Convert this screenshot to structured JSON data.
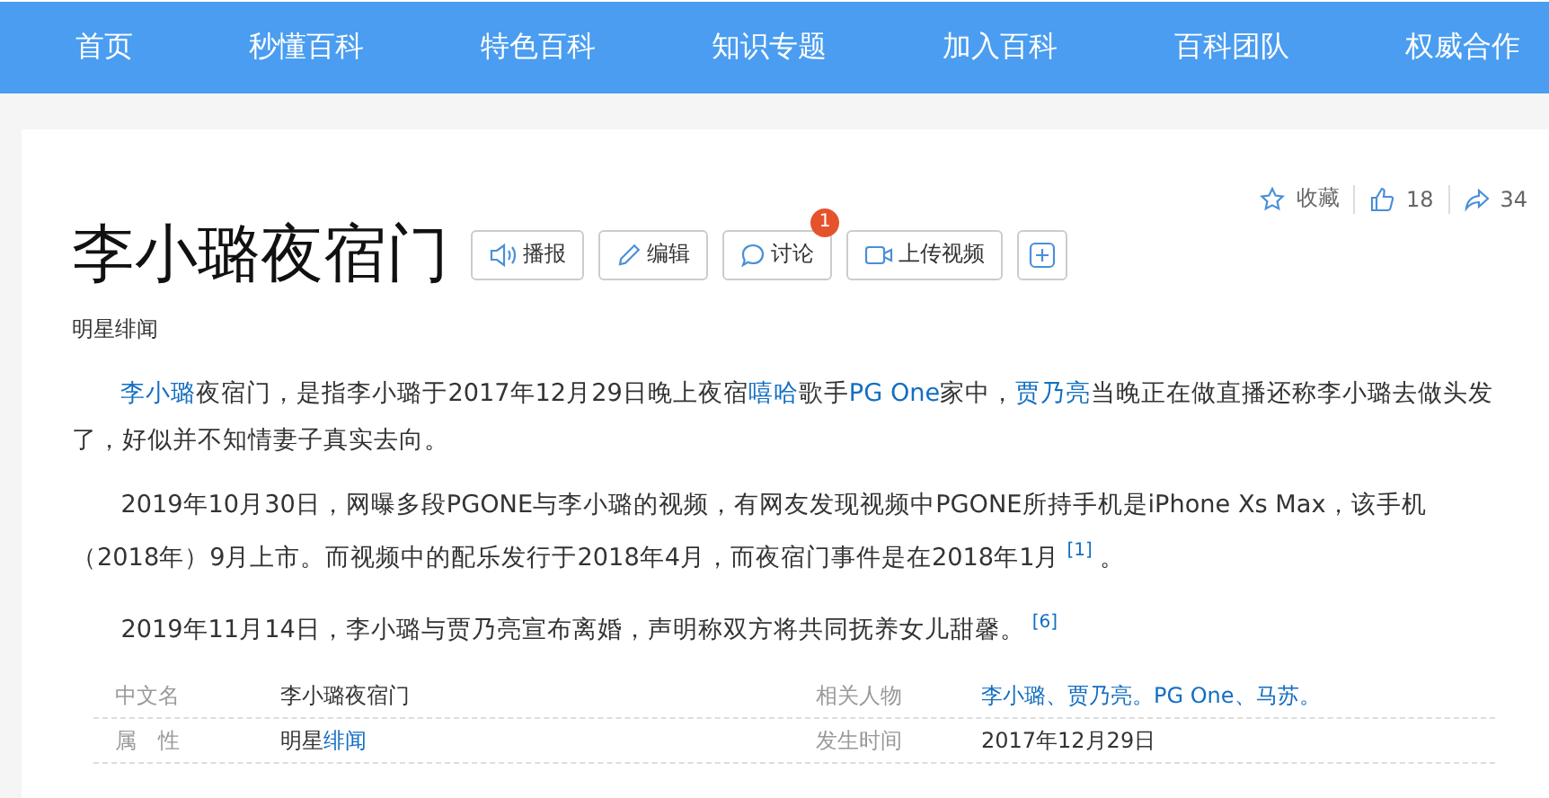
{
  "nav": [
    {
      "label": "首页"
    },
    {
      "label": "秒懂百科"
    },
    {
      "label": "特色百科"
    },
    {
      "label": "知识专题"
    },
    {
      "label": "加入百科"
    },
    {
      "label": "百科团队"
    },
    {
      "label": "权威合作"
    }
  ],
  "actions": {
    "favorite": "收藏",
    "likes": "18",
    "shares": "34"
  },
  "title": "李小璐夜宿门",
  "tools": [
    {
      "kind": "speaker",
      "label": "播报"
    },
    {
      "kind": "pencil",
      "label": "编辑"
    },
    {
      "kind": "chat",
      "label": "讨论",
      "badge": "1"
    },
    {
      "kind": "video",
      "label": "上传视频"
    },
    {
      "kind": "plus"
    }
  ],
  "category": "明星绯闻",
  "paragraphs": [
    {
      "segments": [
        {
          "text": "李小璐",
          "link": true
        },
        {
          "text": "夜宿门，是指李小璐于2017年12月29日晚上夜宿",
          "link": false
        },
        {
          "text": "嘻哈",
          "link": true
        },
        {
          "text": "歌手",
          "link": false
        },
        {
          "text": "PG One",
          "link": true
        },
        {
          "text": "家中，",
          "link": false
        },
        {
          "text": "贾乃亮",
          "link": true
        },
        {
          "text": "当晚正在做直播还称李小璐去做头发了，好似并不知情妻子真实去向。",
          "link": false
        }
      ]
    },
    {
      "segments": [
        {
          "text": "2019年10月30日，网曝多段PGONE与李小璐的视频，有网友发现视频中PGONE所持手机是iPhone Xs Max，该手机（2018年）9月上市。而视频中的配乐发行于2018年4月，而夜宿门事件是在2018年1月",
          "link": false
        }
      ],
      "ref": "[1]",
      "tail": "。"
    },
    {
      "segments": [
        {
          "text": "2019年11月14日，李小璐与贾乃亮宣布离婚，声明称双方将共同抚养女儿甜馨。",
          "link": false
        }
      ],
      "ref": "[6]"
    }
  ],
  "infobox": [
    [
      {
        "label": "中文名",
        "value": [
          {
            "text": "李小璐夜宿门",
            "link": false
          }
        ]
      },
      {
        "label": "相关人物",
        "value": [
          {
            "text": "李小璐、贾乃亮。PG One、马苏。",
            "link": true
          }
        ]
      }
    ],
    [
      {
        "label": "属　性",
        "value": [
          {
            "text": "明星",
            "link": false
          },
          {
            "text": "绯闻",
            "link": true
          }
        ]
      },
      {
        "label": "发生时间",
        "value": [
          {
            "text": "2017年12月29日",
            "link": false
          }
        ]
      }
    ]
  ]
}
